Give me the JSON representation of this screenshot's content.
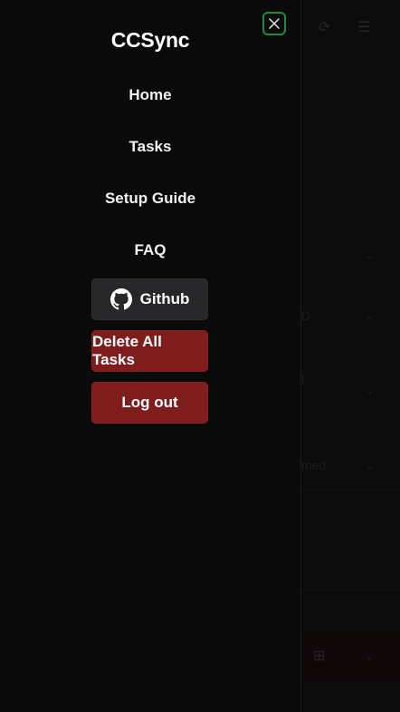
{
  "drawer": {
    "brand": "CCSync",
    "nav": [
      {
        "label": "Home"
      },
      {
        "label": "Tasks"
      },
      {
        "label": "Setup Guide"
      },
      {
        "label": "FAQ"
      }
    ],
    "buttons": {
      "github_label": "Github",
      "delete_all_label": "Delete All Tasks",
      "logout_label": "Log out"
    },
    "close_icon": "close-icon"
  },
  "background": {
    "partial_texts": [
      "D",
      "t",
      "med"
    ]
  },
  "colors": {
    "background": "#0b0a0a",
    "close_border": "#1e8a3c",
    "danger": "#7f1d1d",
    "secondary": "#27272a",
    "text": "#ffffff"
  }
}
